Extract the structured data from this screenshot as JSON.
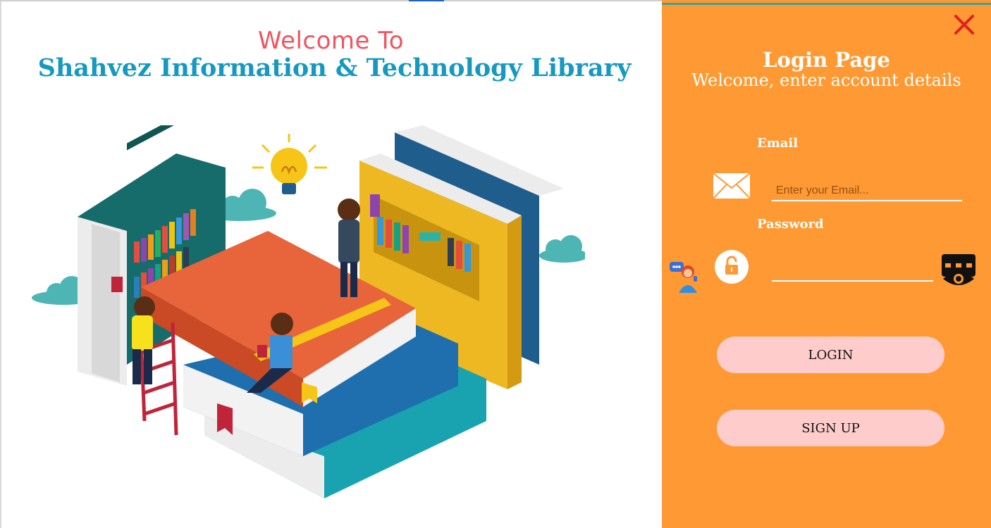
{
  "header": {
    "welcome_line": "Welcome To",
    "library_name": "Shahvez Information & Technology Library"
  },
  "login_panel": {
    "title": "Login Page",
    "subtitle": "Welcome, enter account details",
    "email_label": "Email",
    "email_placeholder": "Enter your Email...",
    "email_value": "",
    "password_label": "Password",
    "password_value": "",
    "login_button": "LOGIN",
    "signup_button": "SIGN UP"
  },
  "icons": {
    "close": "close-icon",
    "mail": "mail-icon",
    "lock": "lock-icon",
    "eye": "eye-icon",
    "support": "support-chat-icon"
  },
  "colors": {
    "panel_bg": "#ff9933",
    "button_bg": "#ffcccc",
    "welcome_color": "#ef5560",
    "title_color": "#1599c1",
    "close_color": "#e02020"
  }
}
